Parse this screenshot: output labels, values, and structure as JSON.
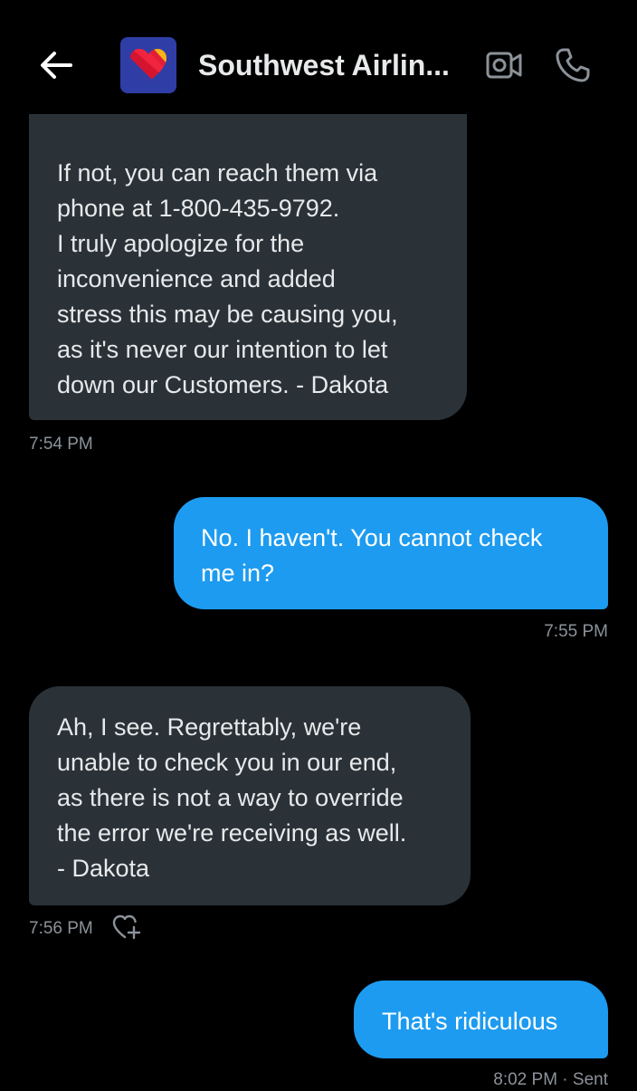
{
  "header": {
    "title": "Southwest Airlin...",
    "back_icon": "arrow-left-icon",
    "avatar_icon": "heart-logo-icon",
    "video_icon": "video-camera-icon",
    "phone_icon": "phone-icon",
    "avatar_bg": "#2f3ea6"
  },
  "messages": [
    {
      "direction": "incoming",
      "text": "If not, you can reach them via\nphone at 1-800-435-9792.\nI truly apologize for the\ninconvenience and added\nstress this may be causing you,\nas it's never our intention to let\ndown our Customers. - Dakota",
      "time": "7:54 PM"
    },
    {
      "direction": "outgoing",
      "text": "No. I haven't. You cannot check\nme in?",
      "time": "7:55 PM"
    },
    {
      "direction": "incoming",
      "text": "Ah, I see. Regrettably, we're\nunable to check you in our end,\nas there is not a way to override\nthe error we're receiving as well.\n- Dakota",
      "time": "7:56 PM",
      "reaction_icon": "add-reaction-heart-icon"
    },
    {
      "direction": "outgoing",
      "text": "That's ridiculous",
      "time": "8:02 PM · Sent"
    }
  ],
  "colors": {
    "incoming_bubble": "#2a3238",
    "outgoing_bubble": "#1d9bf0",
    "timestamp": "#8b9299",
    "background": "#000000"
  }
}
